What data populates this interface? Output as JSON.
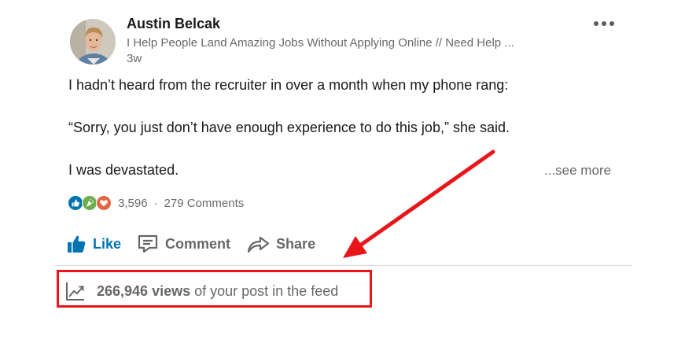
{
  "post": {
    "author": {
      "name": "Austin Belcak",
      "headline": "I Help People Land Amazing Jobs Without Applying Online // Need Help ...",
      "time": "3w"
    },
    "text": {
      "line1": "I hadn’t heard from the recruiter in over a month when my phone rang:",
      "line2": "“Sorry, you just don’t have enough experience to do this job,” she said.",
      "line3": "I was devastated."
    },
    "see_more": "...see more",
    "social": {
      "reaction_icons": [
        "like-reaction-icon",
        "celebrate-reaction-icon",
        "love-reaction-icon"
      ],
      "reaction_count": "3,596",
      "separator": "·",
      "comments": "279 Comments"
    },
    "actions": {
      "like": "Like",
      "comment": "Comment",
      "share": "Share"
    },
    "analytics": {
      "views_count": "266,946 views",
      "views_suffix": "of your post in the feed"
    }
  },
  "annotation": {
    "highlight_color": "#e8161b"
  },
  "colors": {
    "like_blue": "#0073b1",
    "love_red": "#e06847",
    "celebrate_green": "#6dae4f"
  }
}
